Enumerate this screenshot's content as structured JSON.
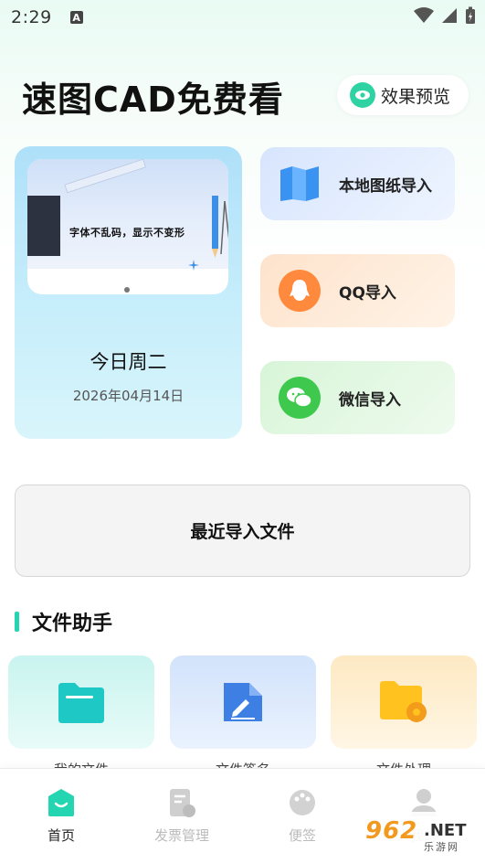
{
  "status_bar": {
    "time": "2:29",
    "notification_letter": "A"
  },
  "header": {
    "title": "速图CAD免费看",
    "preview_button": "效果预览"
  },
  "date_card": {
    "banner_text": "字体不乱码，显示不变形",
    "weekday": "今日周二",
    "date": "2026年04月14日"
  },
  "imports": {
    "local": "本地图纸导入",
    "qq": "QQ导入",
    "wechat": "微信导入"
  },
  "recent": {
    "label": "最近导入文件"
  },
  "assistant": {
    "title": "文件助手",
    "tools": [
      "我的文件",
      "文件签名",
      "文件处理"
    ]
  },
  "nav": {
    "items": [
      "首页",
      "发票管理",
      "便签",
      "我的"
    ],
    "active": "首页"
  },
  "watermark": {
    "number": "962",
    "suffix": ".NET",
    "site": "乐游网"
  },
  "colors": {
    "accent": "#23d5b0",
    "qq": "#ff8a3d",
    "wechat": "#3ec94e",
    "local_map": "#3b93f1"
  }
}
